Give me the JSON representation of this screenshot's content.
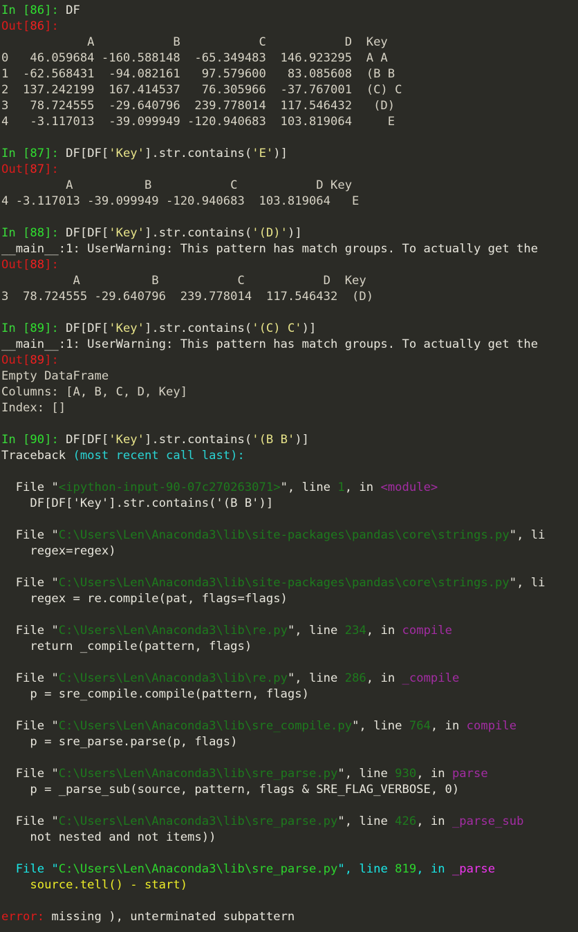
{
  "terminal": {
    "title": "IPython Console",
    "background_color": "#2b2b26",
    "default_text_color": "#d6d2c4",
    "colors": {
      "in_prompt": "#3ad93a",
      "out_prompt": "#d91b1b",
      "string_literal": "#e8e48a",
      "traceback_header": "#2ad4d4",
      "path_dim": "#1d7a1d",
      "function_dim": "#a32ca3",
      "highlight_file": "#1ae7e7",
      "highlight_path": "#2dd52d",
      "highlight_func": "#ef36ef",
      "highlight_source": "#ecec28",
      "error": "#e01b1b"
    }
  },
  "cells": [
    {
      "in_prompt": "In [",
      "in_number": "86",
      "in_close": "]: ",
      "in_code": "DF",
      "out_prompt": "Out[",
      "out_number": "86",
      "out_close": "]:",
      "table": {
        "header": "            A           B           C           D  Key",
        "rows": [
          "0   46.059684 -160.588148  -65.349483  146.923295  A A",
          "1  -62.568431  -94.082161   97.579600   83.085608  (B B",
          "2  137.242199  167.414537   76.305966  -37.767001  (C) C",
          "3   78.724555  -29.640796  239.778014  117.546432   (D)",
          "4   -3.117013  -39.099949 -120.940683  103.819064     E"
        ]
      }
    },
    {
      "in_prompt": "In [",
      "in_number": "87",
      "in_close": "]: ",
      "code_pre": "DF[DF[",
      "code_str1": "'Key'",
      "code_mid": "].str.contains(",
      "code_str2": "'E'",
      "code_post": ")]",
      "out_prompt": "Out[",
      "out_number": "87",
      "out_close": "]:",
      "table": {
        "header": "         A          B           C           D Key",
        "rows": [
          "4 -3.117013 -39.099949 -120.940683  103.819064   E"
        ]
      }
    },
    {
      "in_prompt": "In [",
      "in_number": "88",
      "in_close": "]: ",
      "code_pre": "DF[DF[",
      "code_str1": "'Key'",
      "code_mid": "].str.contains(",
      "code_str2": "'(D)'",
      "code_post": ")]",
      "warning": "__main__:1: UserWarning: This pattern has match groups. To actually get the",
      "out_prompt": "Out[",
      "out_number": "88",
      "out_close": "]:",
      "table": {
        "header": "          A          B           C           D  Key",
        "rows": [
          "3  78.724555 -29.640796  239.778014  117.546432  (D)"
        ]
      }
    },
    {
      "in_prompt": "In [",
      "in_number": "89",
      "in_close": "]: ",
      "code_pre": "DF[DF[",
      "code_str1": "'Key'",
      "code_mid": "].str.contains(",
      "code_str2": "'(C) C'",
      "code_post": ")]",
      "warning": "__main__:1: UserWarning: This pattern has match groups. To actually get the",
      "out_prompt": "Out[",
      "out_number": "89",
      "out_close": "]:",
      "empty_frame": [
        "Empty DataFrame",
        "Columns: [A, B, C, D, Key]",
        "Index: []"
      ]
    },
    {
      "in_prompt": "In [",
      "in_number": "90",
      "in_close": "]: ",
      "code_pre": "DF[DF[",
      "code_str1": "'Key'",
      "code_mid": "].str.contains(",
      "code_str2": "'(B B'",
      "code_post": ")]",
      "traceback_label": "Traceback ",
      "traceback_suffix": "(most recent call last):"
    }
  ],
  "traceback_frames": [
    {
      "file_kw": "  File ",
      "quote_open": "\"",
      "path": "<ipython-input-90-07c270263071>",
      "quote_close": "\", line ",
      "lineno": "1",
      "in_kw": ", in ",
      "func": "<module>",
      "source": "    DF[DF['Key'].str.contains('(B B')]",
      "highlighted": false
    },
    {
      "file_kw": "  File ",
      "quote_open": "\"",
      "path": "C:\\Users\\Len\\Anaconda3\\lib\\site-packages\\pandas\\core\\strings.py",
      "quote_close": "\", li",
      "lineno": "",
      "in_kw": "",
      "func": "",
      "source": "    regex=regex)",
      "highlighted": false
    },
    {
      "file_kw": "  File ",
      "quote_open": "\"",
      "path": "C:\\Users\\Len\\Anaconda3\\lib\\site-packages\\pandas\\core\\strings.py",
      "quote_close": "\", li",
      "lineno": "",
      "in_kw": "",
      "func": "",
      "source": "    regex = re.compile(pat, flags=flags)",
      "highlighted": false
    },
    {
      "file_kw": "  File ",
      "quote_open": "\"",
      "path": "C:\\Users\\Len\\Anaconda3\\lib\\re.py",
      "quote_close": "\", line ",
      "lineno": "234",
      "in_kw": ", in ",
      "func": "compile",
      "source": "    return _compile(pattern, flags)",
      "highlighted": false
    },
    {
      "file_kw": "  File ",
      "quote_open": "\"",
      "path": "C:\\Users\\Len\\Anaconda3\\lib\\re.py",
      "quote_close": "\", line ",
      "lineno": "286",
      "in_kw": ", in ",
      "func": "_compile",
      "source": "    p = sre_compile.compile(pattern, flags)",
      "highlighted": false
    },
    {
      "file_kw": "  File ",
      "quote_open": "\"",
      "path": "C:\\Users\\Len\\Anaconda3\\lib\\sre_compile.py",
      "quote_close": "\", line ",
      "lineno": "764",
      "in_kw": ", in ",
      "func": "compile",
      "source": "    p = sre_parse.parse(p, flags)",
      "highlighted": false
    },
    {
      "file_kw": "  File ",
      "quote_open": "\"",
      "path": "C:\\Users\\Len\\Anaconda3\\lib\\sre_parse.py",
      "quote_close": "\", line ",
      "lineno": "930",
      "in_kw": ", in ",
      "func": "parse",
      "source": "    p = _parse_sub(source, pattern, flags & SRE_FLAG_VERBOSE, 0)",
      "highlighted": false
    },
    {
      "file_kw": "  File ",
      "quote_open": "\"",
      "path": "C:\\Users\\Len\\Anaconda3\\lib\\sre_parse.py",
      "quote_close": "\", line ",
      "lineno": "426",
      "in_kw": ", in ",
      "func": "_parse_sub",
      "source": "    not nested and not items))",
      "highlighted": false
    },
    {
      "file_kw": "  File ",
      "quote_open": "\"",
      "path": "C:\\Users\\Len\\Anaconda3\\lib\\sre_parse.py",
      "quote_close": "\", line ",
      "lineno": "819",
      "in_kw": ", in ",
      "func": "_parse",
      "source": "    source.tell() - start)",
      "highlighted": true
    }
  ],
  "error": {
    "label": "error:",
    "message": " missing ), unterminated subpattern"
  }
}
